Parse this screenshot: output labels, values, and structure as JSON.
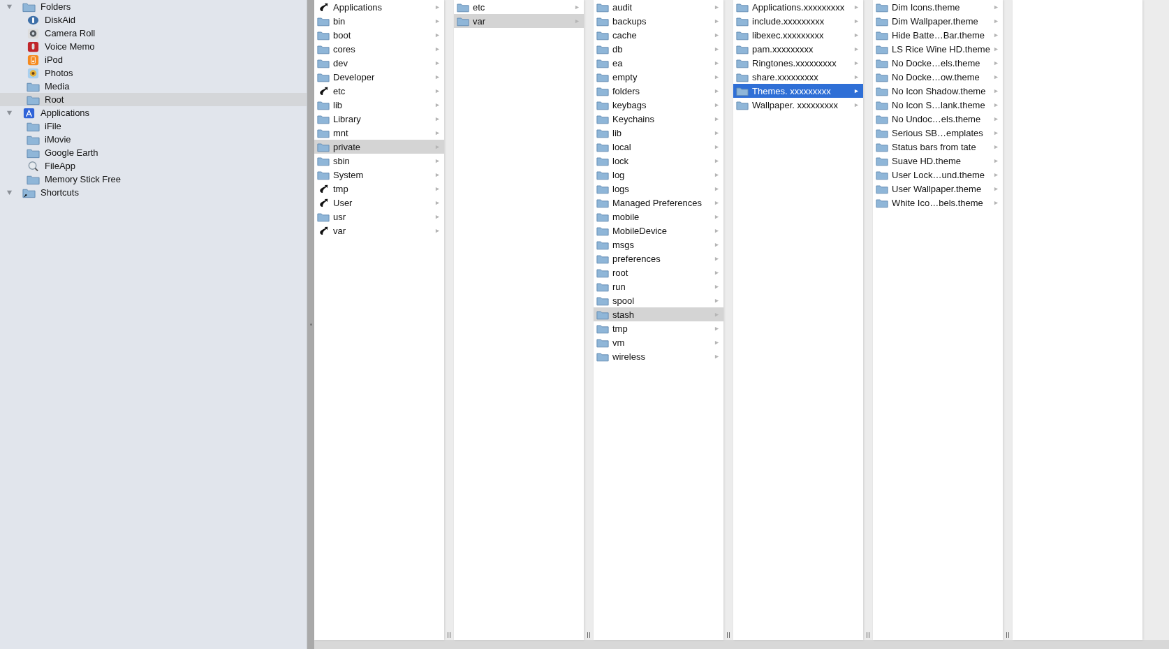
{
  "sidebar": {
    "groups": [
      {
        "label": "Folders",
        "kind": "folder",
        "expanded": true,
        "children": [
          {
            "label": "DiskAid",
            "kind": "disk",
            "selected": false
          },
          {
            "label": "Camera Roll",
            "kind": "camera",
            "selected": false
          },
          {
            "label": "Voice Memo",
            "kind": "microphone",
            "selected": false
          },
          {
            "label": "iPod",
            "kind": "player",
            "selected": false
          },
          {
            "label": "Photos",
            "kind": "photos",
            "selected": false
          },
          {
            "label": "Media",
            "kind": "folder",
            "selected": false
          },
          {
            "label": "Root",
            "kind": "folder",
            "selected": true
          }
        ]
      },
      {
        "label": "Applications",
        "kind": "apps",
        "expanded": true,
        "children": [
          {
            "label": "iFile",
            "kind": "folder",
            "selected": false
          },
          {
            "label": "iMovie",
            "kind": "folder",
            "selected": false
          },
          {
            "label": "Google Earth",
            "kind": "folder",
            "selected": false
          },
          {
            "label": "FileApp",
            "kind": "magnifier",
            "selected": false
          },
          {
            "label": "Memory Stick Free",
            "kind": "folder",
            "selected": false
          }
        ]
      },
      {
        "label": "Shortcuts",
        "kind": "shortcut",
        "expanded": true
      }
    ]
  },
  "columns": [
    {
      "items": [
        {
          "name": "Applications",
          "kind": "link",
          "selected": false
        },
        {
          "name": "bin",
          "kind": "folder",
          "selected": false
        },
        {
          "name": "boot",
          "kind": "folder",
          "selected": false
        },
        {
          "name": "cores",
          "kind": "folder",
          "selected": false
        },
        {
          "name": "dev",
          "kind": "folder",
          "selected": false
        },
        {
          "name": "Developer",
          "kind": "folder",
          "selected": false
        },
        {
          "name": "etc",
          "kind": "link",
          "selected": false
        },
        {
          "name": "lib",
          "kind": "folder",
          "selected": false
        },
        {
          "name": "Library",
          "kind": "folder",
          "selected": false
        },
        {
          "name": "mnt",
          "kind": "folder",
          "selected": false
        },
        {
          "name": "private",
          "kind": "folder",
          "selected": true
        },
        {
          "name": "sbin",
          "kind": "folder",
          "selected": false
        },
        {
          "name": "System",
          "kind": "folder",
          "selected": false
        },
        {
          "name": "tmp",
          "kind": "link",
          "selected": false
        },
        {
          "name": "User",
          "kind": "link",
          "selected": false
        },
        {
          "name": "usr",
          "kind": "folder",
          "selected": false
        },
        {
          "name": "var",
          "kind": "link",
          "selected": false
        }
      ]
    },
    {
      "items": [
        {
          "name": "etc",
          "kind": "folder",
          "selected": false
        },
        {
          "name": "var",
          "kind": "folder",
          "selected": true
        }
      ]
    },
    {
      "items": [
        {
          "name": "audit",
          "kind": "folder",
          "selected": false
        },
        {
          "name": "backups",
          "kind": "folder",
          "selected": false
        },
        {
          "name": "cache",
          "kind": "folder",
          "selected": false
        },
        {
          "name": "db",
          "kind": "folder",
          "selected": false
        },
        {
          "name": "ea",
          "kind": "folder",
          "selected": false
        },
        {
          "name": "empty",
          "kind": "folder",
          "selected": false
        },
        {
          "name": "folders",
          "kind": "folder",
          "selected": false
        },
        {
          "name": "keybags",
          "kind": "folder",
          "selected": false
        },
        {
          "name": "Keychains",
          "kind": "folder",
          "selected": false
        },
        {
          "name": "lib",
          "kind": "folder",
          "selected": false
        },
        {
          "name": "local",
          "kind": "folder",
          "selected": false
        },
        {
          "name": "lock",
          "kind": "folder",
          "selected": false
        },
        {
          "name": "log",
          "kind": "folder",
          "selected": false
        },
        {
          "name": "logs",
          "kind": "folder",
          "selected": false
        },
        {
          "name": "Managed Preferences",
          "kind": "folder",
          "selected": false
        },
        {
          "name": "mobile",
          "kind": "folder",
          "selected": false
        },
        {
          "name": "MobileDevice",
          "kind": "folder",
          "selected": false
        },
        {
          "name": "msgs",
          "kind": "folder",
          "selected": false
        },
        {
          "name": "preferences",
          "kind": "folder",
          "selected": false
        },
        {
          "name": "root",
          "kind": "folder",
          "selected": false
        },
        {
          "name": "run",
          "kind": "folder",
          "selected": false
        },
        {
          "name": "spool",
          "kind": "folder",
          "selected": false
        },
        {
          "name": "stash",
          "kind": "folder",
          "selected": true
        },
        {
          "name": "tmp",
          "kind": "folder",
          "selected": false
        },
        {
          "name": "vm",
          "kind": "folder",
          "selected": false
        },
        {
          "name": "wireless",
          "kind": "folder",
          "selected": false
        }
      ]
    },
    {
      "items": [
        {
          "name": "Applications.xxxxxxxxx",
          "kind": "folder",
          "selected": false
        },
        {
          "name": "include.xxxxxxxxx",
          "kind": "folder",
          "selected": false
        },
        {
          "name": "libexec.xxxxxxxxx",
          "kind": "folder",
          "selected": false
        },
        {
          "name": "pam.xxxxxxxxx",
          "kind": "folder",
          "selected": false
        },
        {
          "name": "Ringtones.xxxxxxxxx",
          "kind": "folder",
          "selected": false
        },
        {
          "name": "share.xxxxxxxxx",
          "kind": "folder",
          "selected": false
        },
        {
          "name": "Themes. xxxxxxxxx",
          "kind": "folder",
          "selected": true
        },
        {
          "name": "Wallpaper. xxxxxxxxx",
          "kind": "folder",
          "selected": false
        }
      ]
    },
    {
      "items": [
        {
          "name": "Dim Icons.theme",
          "kind": "folder",
          "selected": false
        },
        {
          "name": "Dim Wallpaper.theme",
          "kind": "folder",
          "selected": false
        },
        {
          "name": "Hide Batte…Bar.theme",
          "kind": "folder",
          "selected": false
        },
        {
          "name": "LS Rice Wine HD.theme",
          "kind": "folder",
          "selected": false
        },
        {
          "name": "No Docke…els.theme",
          "kind": "folder",
          "selected": false
        },
        {
          "name": "No Docke…ow.theme",
          "kind": "folder",
          "selected": false
        },
        {
          "name": "No Icon Shadow.theme",
          "kind": "folder",
          "selected": false
        },
        {
          "name": "No Icon S…lank.theme",
          "kind": "folder",
          "selected": false
        },
        {
          "name": "No Undoc…els.theme",
          "kind": "folder",
          "selected": false
        },
        {
          "name": "Serious SB…emplates",
          "kind": "folder",
          "selected": false
        },
        {
          "name": "Status bars from tate",
          "kind": "folder",
          "selected": false
        },
        {
          "name": "Suave HD.theme",
          "kind": "folder",
          "selected": false
        },
        {
          "name": "User Lock…und.theme",
          "kind": "folder",
          "selected": false
        },
        {
          "name": "User Wallpaper.theme",
          "kind": "folder",
          "selected": false
        },
        {
          "name": "White Ico…bels.theme",
          "kind": "folder",
          "selected": false
        }
      ]
    }
  ]
}
